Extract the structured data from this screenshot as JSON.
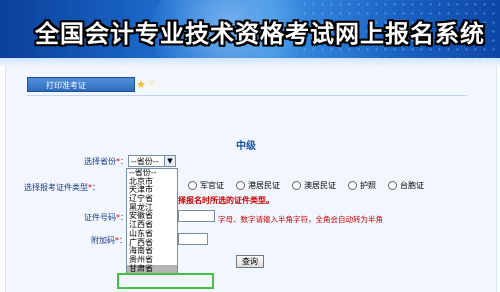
{
  "header": {
    "title": "全国会计专业技术资格考试网上报名系统"
  },
  "tab": {
    "label": "打印准考证"
  },
  "level": {
    "title": "中级"
  },
  "form": {
    "province_label": "选择省份",
    "province_selected": "--省份--",
    "province_options": [
      "--省份--",
      "北京市",
      "天津市",
      "辽宁省",
      "黑龙江",
      "安徽省",
      "江西省",
      "山东省",
      "广西省",
      "海南省",
      "贵州省",
      "甘肃省"
    ],
    "province_highlighted": "甘肃省",
    "id_type_label": "选择报考证件类型",
    "id_types": [
      "军官证",
      "港居民证",
      "澳居民证",
      "护照",
      "台胞证"
    ],
    "id_warning": "择报名时所选的证件类型。",
    "id_number_label": "证件号码",
    "id_hint": "字母、数字请输入半角字符，全角会自动转为半角",
    "code_label": "附加码",
    "required_mark": "*",
    "submit_label": "查询"
  },
  "colors": {
    "banner": "#1d6fd0",
    "warning": "#d00000",
    "highlight": "#43c243"
  }
}
